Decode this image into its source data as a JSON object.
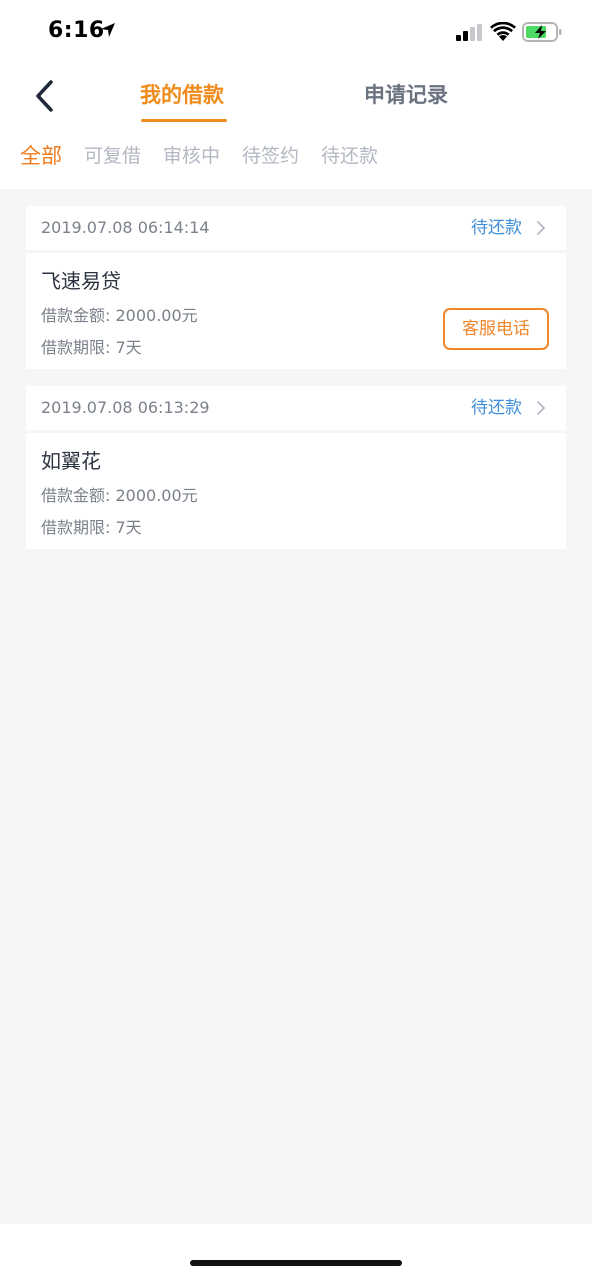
{
  "status_bar": {
    "time": "6:16",
    "icons": [
      "location-arrow-icon",
      "cellular-signal-icon",
      "wifi-icon",
      "battery-charging-icon"
    ]
  },
  "nav": {
    "back_icon": "chevron-left-icon",
    "tabs": [
      {
        "label": "我的借款",
        "active": true
      },
      {
        "label": "申请记录",
        "active": false
      }
    ]
  },
  "filters": [
    {
      "label": "全部",
      "active": true
    },
    {
      "label": "可复借",
      "active": false
    },
    {
      "label": "审核中",
      "active": false
    },
    {
      "label": "待签约",
      "active": false
    },
    {
      "label": "待还款",
      "active": false
    }
  ],
  "loans": [
    {
      "time": "2019.07.08 06:14:14",
      "status": "待还款",
      "name": "飞速易贷",
      "amount": "借款金额: 2000.00元",
      "term": "借款期限: 7天",
      "service_label": "客服电话"
    },
    {
      "time": "2019.07.08 06:13:29",
      "status": "待还款",
      "name": "如翼花",
      "amount": "借款金额: 2000.00元",
      "term": "借款期限: 7天"
    }
  ],
  "colors": {
    "accent": "#f08c1e",
    "status_blue": "#3f8fd8",
    "background": "#f5f6f8"
  }
}
